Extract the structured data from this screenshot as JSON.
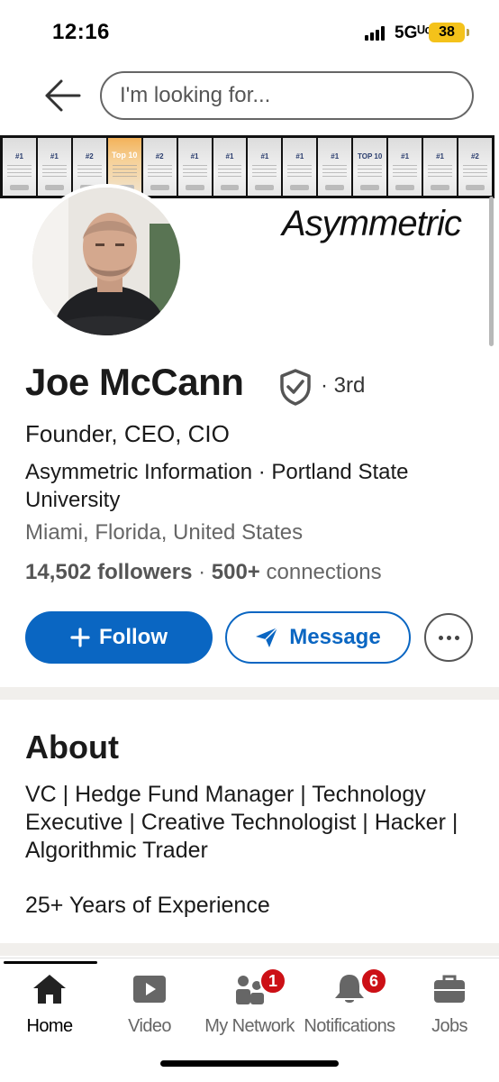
{
  "status_bar": {
    "time": "12:16",
    "network": "5Gᵁᶜ",
    "battery": "38"
  },
  "search": {
    "placeholder": "I'm looking for..."
  },
  "banner": {
    "brand": "Asymmetric",
    "awards": [
      "#1",
      "#1",
      "#2",
      "Top 10",
      "#2",
      "#1",
      "#1",
      "#1",
      "#1",
      "#1",
      "TOP 10",
      "#1",
      "#1",
      "#2"
    ]
  },
  "profile": {
    "name": "Joe McCann",
    "degree": "· 3rd",
    "headline": "Founder, CEO, CIO",
    "affiliation": "Asymmetric Information · Portland State University",
    "location": "Miami, Florida, United States",
    "followers": "14,502 followers",
    "separator": " · ",
    "connections_count": "500+",
    "connections_label": " connections"
  },
  "actions": {
    "follow": "Follow",
    "message": "Message"
  },
  "about": {
    "title": "About",
    "text": "VC | Hedge Fund Manager | Technology Executive | Creative Technologist | Hacker | Algorithmic Trader",
    "experience": "25+ Years of Experience"
  },
  "nav": {
    "home": "Home",
    "video": "Video",
    "network": "My Network",
    "network_badge": "1",
    "notifications": "Notifications",
    "notifications_badge": "6",
    "jobs": "Jobs"
  },
  "colors": {
    "brand_blue": "#0a66c2",
    "badge_red": "#cc1016",
    "battery_yellow": "#f4c21a"
  }
}
